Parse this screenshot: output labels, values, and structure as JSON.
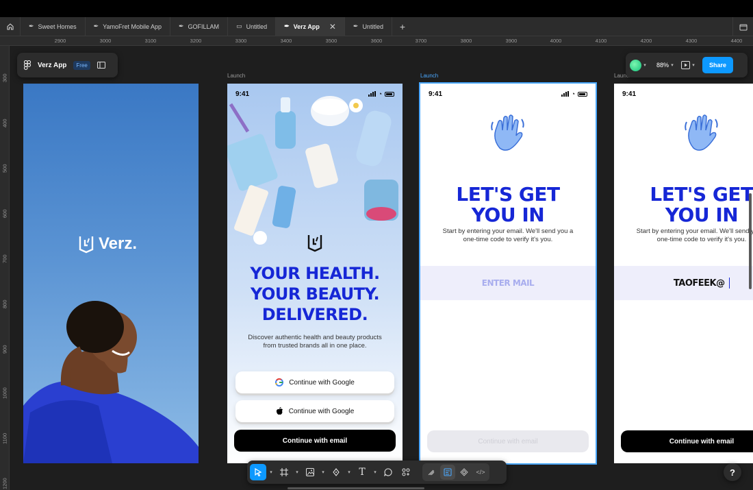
{
  "tabs": [
    {
      "label": "Sweet Homes",
      "active": false
    },
    {
      "label": "YamoFret Mobile App",
      "active": false
    },
    {
      "label": "GOFILLAM",
      "active": false
    },
    {
      "label": "Untitled",
      "active": false
    },
    {
      "label": "Verz App",
      "active": true
    },
    {
      "label": "Untitled",
      "active": false
    }
  ],
  "ruler_top": [
    "2900",
    "3000",
    "3100",
    "3200",
    "3300",
    "3400",
    "3500",
    "3600",
    "3700",
    "3800",
    "3900",
    "4000",
    "4100",
    "4200",
    "4300",
    "4400"
  ],
  "ruler_left": [
    "300",
    "400",
    "500",
    "600",
    "700",
    "800",
    "900",
    "1000",
    "1100",
    "1200"
  ],
  "file_panel": {
    "name": "Verz App",
    "plan_badge": "Free"
  },
  "right_panel": {
    "zoom": "88%",
    "share_label": "Share"
  },
  "frames": {
    "labels": [
      "Launch",
      "Launch",
      "Launch",
      "Launch"
    ],
    "splash": {
      "logo_text": "Verz."
    },
    "onboarding": {
      "time": "9:41",
      "headline": [
        "YOUR HEALTH.",
        "YOUR BEAUTY.",
        "DELIVERED."
      ],
      "subtext": "Discover authentic health and beauty products from trusted brands all in one place.",
      "google_button": "Continue with Google",
      "apple_button": "Continue with Google",
      "email_button": "Continue with email"
    },
    "login_empty": {
      "time": "9:41",
      "headline": [
        "LET'S GET",
        "YOU IN"
      ],
      "subtext": "Start by entering your email. We'll send you a one-time code to verify it's you.",
      "input_placeholder": "ENTER MAIL",
      "email_button": "Continue with email"
    },
    "login_filled": {
      "time": "9:41",
      "headline": [
        "LET'S GET",
        "YOU IN"
      ],
      "subtext": "Start by entering your email. We'll send you a one-time code to verify it's you.",
      "input_value": "TAOFEEK@",
      "email_button": "Continue with email"
    }
  },
  "toolbar": {
    "help_label": "?"
  },
  "colors": {
    "accent": "#0d99ff",
    "brand_blue": "#1627d6",
    "canvas": "#1e1e1e",
    "chrome": "#2c2c2c"
  }
}
